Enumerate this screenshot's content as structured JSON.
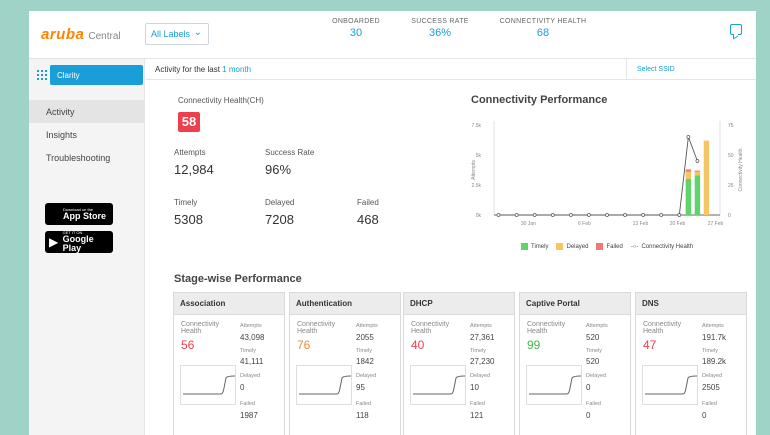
{
  "header": {
    "brand": "aruba",
    "product": "Central",
    "label_select": "All Labels",
    "stats": [
      {
        "label": "ONBOARDED",
        "value": "30"
      },
      {
        "label": "SUCCESS RATE",
        "value": "36%"
      },
      {
        "label": "CONNECTIVITY HEALTH",
        "value": "68"
      }
    ]
  },
  "sidebar": {
    "app": "Clarity",
    "items": [
      {
        "label": "Activity",
        "active": true
      },
      {
        "label": "Insights",
        "active": false
      },
      {
        "label": "Troubleshooting",
        "active": false
      }
    ],
    "app_store": {
      "small": "Download on the",
      "big": "App Store"
    },
    "google_play": {
      "small": "GET IT ON",
      "big": "Google Play"
    }
  },
  "subbar": {
    "prefix": "Activity for the last",
    "range": "1 month",
    "ssid": "Select SSID"
  },
  "summary": {
    "ch_label": "Connectivity Health(CH)",
    "ch_value": "58",
    "attempts_label": "Attempts",
    "attempts_value": "12,984",
    "success_label": "Success Rate",
    "success_value": "96%",
    "timely_label": "Timely",
    "timely_value": "5308",
    "delayed_label": "Delayed",
    "delayed_value": "7208",
    "failed_label": "Failed",
    "failed_value": "468"
  },
  "colors": {
    "accent": "#1a9ed8",
    "brand": "#ff8300",
    "timely": "#5ed46a",
    "delayed": "#f7c563",
    "failed": "#f07a7a",
    "bad": "#ee3f4c",
    "warn": "#f08a3c",
    "good": "#45b649"
  },
  "chart_data": {
    "type": "bar",
    "title": "Connectivity Performance",
    "ylabel": "Attempts",
    "y2label": "Connectivity Health",
    "ylim": [
      0,
      7500
    ],
    "y2lim": [
      0,
      75
    ],
    "y_ticks": [
      "0k",
      "2.5k",
      "5k",
      "7.5k"
    ],
    "y2_ticks": [
      "0",
      "25",
      "50",
      "75"
    ],
    "x_ticks": [
      "30 Jan",
      "6 Feb",
      "13 Feb",
      "20 Feb",
      "27 Feb"
    ],
    "bars": [
      {
        "index": 21,
        "timely": 3000,
        "delayed": 600,
        "failed": 200
      },
      {
        "index": 22,
        "timely": 3300,
        "delayed": 300,
        "failed": 100
      },
      {
        "index": 23,
        "timely": 0,
        "delayed": 6200,
        "failed": 0
      }
    ],
    "health_line": [
      {
        "index": 0,
        "value": 0
      },
      {
        "index": 2,
        "value": 0
      },
      {
        "index": 4,
        "value": 0
      },
      {
        "index": 6,
        "value": 0
      },
      {
        "index": 8,
        "value": 0
      },
      {
        "index": 10,
        "value": 0
      },
      {
        "index": 12,
        "value": 0
      },
      {
        "index": 14,
        "value": 0
      },
      {
        "index": 16,
        "value": 0
      },
      {
        "index": 18,
        "value": 0
      },
      {
        "index": 20,
        "value": 0
      },
      {
        "index": 21,
        "value": 65
      },
      {
        "index": 22,
        "value": 45
      }
    ],
    "legend": [
      {
        "name": "Timely",
        "color": "#5ed46a"
      },
      {
        "name": "Delayed",
        "color": "#f7c563"
      },
      {
        "name": "Failed",
        "color": "#f07a7a"
      },
      {
        "name": "Connectivity Health",
        "color": "#555555"
      }
    ]
  },
  "stagewise": {
    "title": "Stage-wise Performance",
    "ch_label": "Connectivity Health",
    "attempts_label": "Attempts",
    "timely_label": "Timely",
    "delayed_label": "Delayed",
    "failed_label": "Failed",
    "stages": [
      {
        "name": "Association",
        "ch": "56",
        "attempts": "43,098",
        "timely": "41,111",
        "delayed": "0",
        "failed": "1987",
        "status": "bad"
      },
      {
        "name": "Authentication",
        "ch": "76",
        "attempts": "2055",
        "timely": "1842",
        "delayed": "95",
        "failed": "118",
        "status": "warn"
      },
      {
        "name": "DHCP",
        "ch": "40",
        "attempts": "27,361",
        "timely": "27,230",
        "delayed": "10",
        "failed": "121",
        "status": "bad"
      },
      {
        "name": "Captive Portal",
        "ch": "99",
        "attempts": "520",
        "timely": "520",
        "delayed": "0",
        "failed": "0",
        "status": "good"
      },
      {
        "name": "DNS",
        "ch": "47",
        "attempts": "191.7k",
        "timely": "189.2k",
        "delayed": "2505",
        "failed": "0",
        "status": "bad"
      }
    ]
  }
}
